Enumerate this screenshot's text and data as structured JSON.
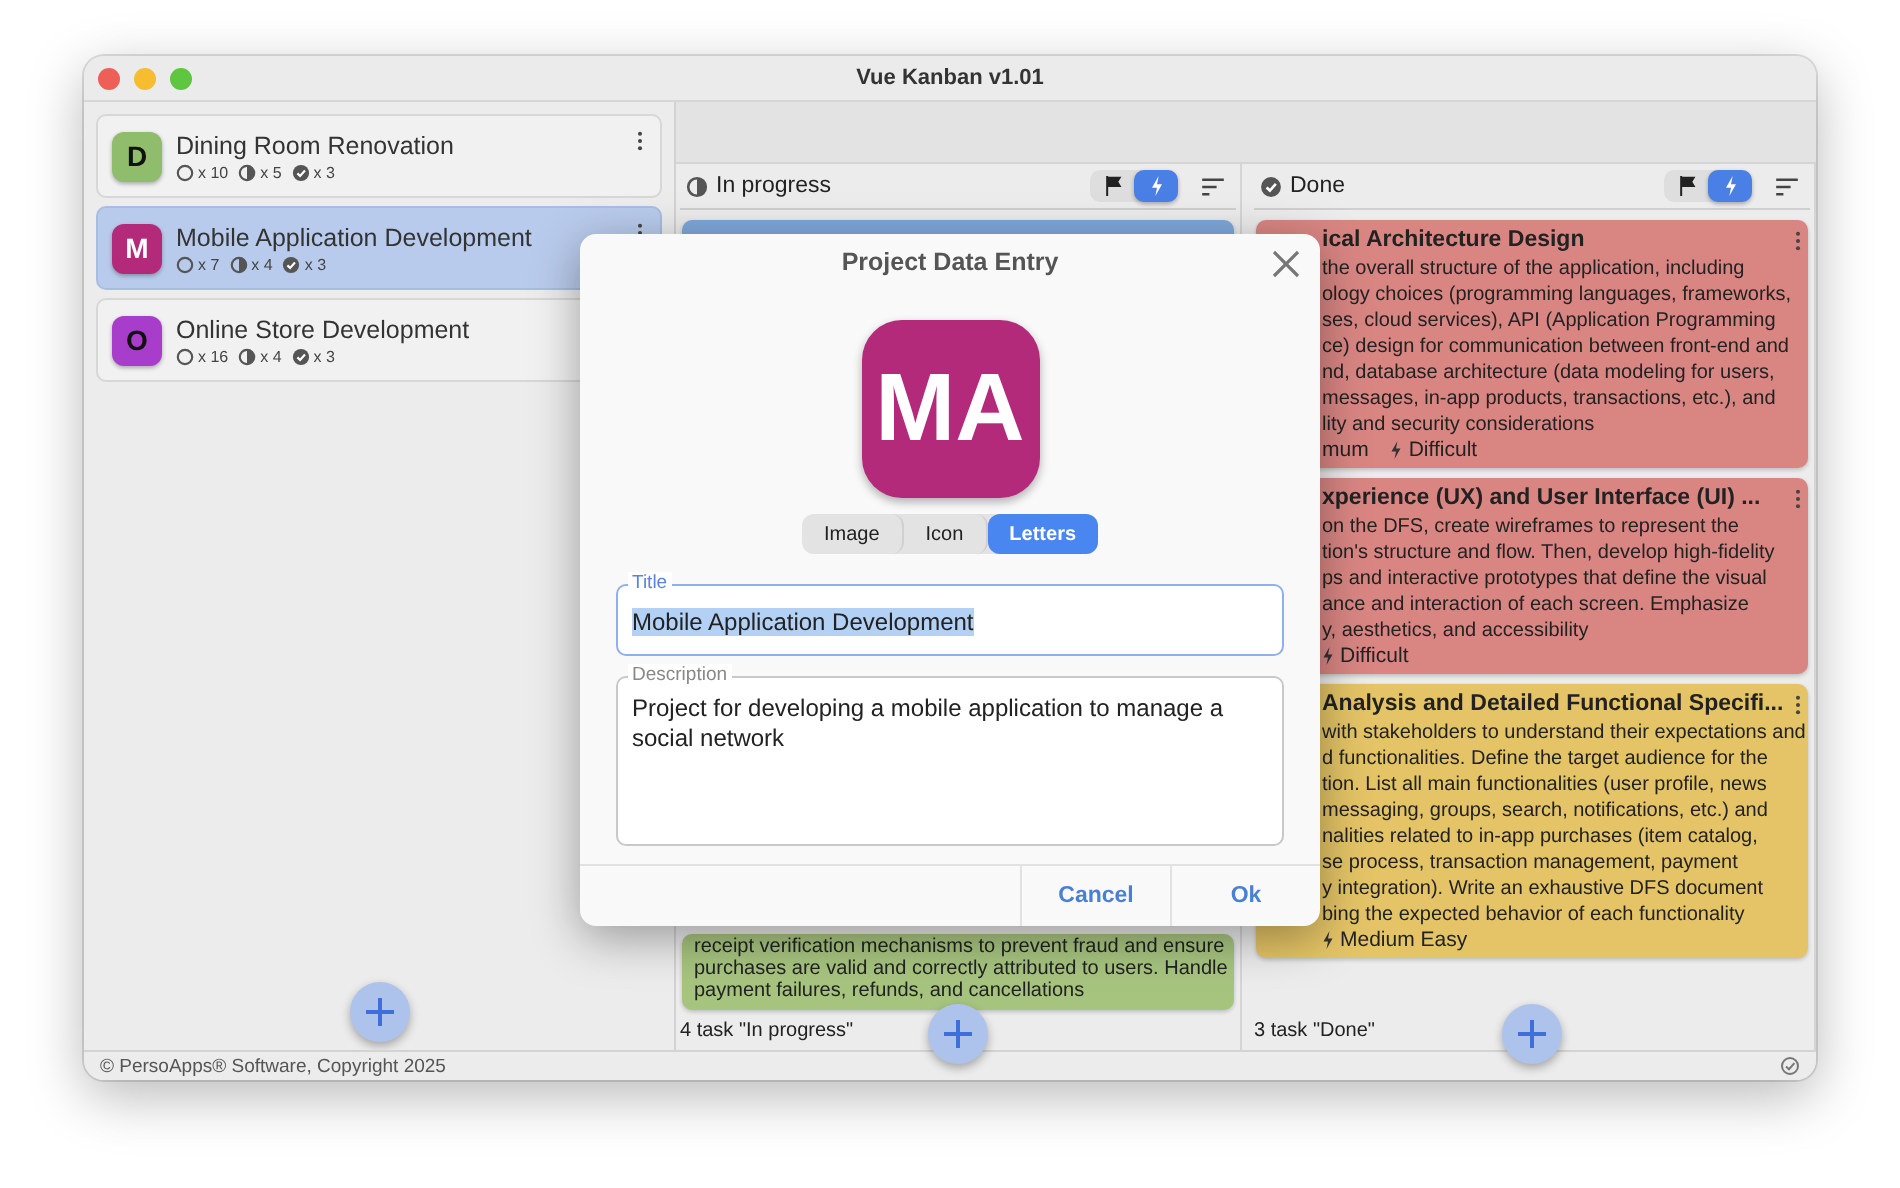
{
  "window": {
    "title": "Vue Kanban v1.01"
  },
  "projects": [
    {
      "letter": "D",
      "color": "#8fbd6c",
      "title": "Dining Room Renovation",
      "todo": "x 10",
      "in_progress": "x 5",
      "done": "x 3",
      "selected": false
    },
    {
      "letter": "M",
      "color": "#b42a7a",
      "title": "Mobile Application Development",
      "todo": "x 7",
      "in_progress": "x 4",
      "done": "x 3",
      "selected": true
    },
    {
      "letter": "O",
      "color": "#a83dcc",
      "title": "Online Store Development",
      "todo": "x 16",
      "in_progress": "x 4",
      "done": "x 3",
      "selected": false
    }
  ],
  "columns": [
    {
      "kind": "in_progress",
      "title": "In progress",
      "filters": [
        {
          "kind": "flag",
          "selected": false
        },
        {
          "kind": "bolt",
          "selected": true
        }
      ],
      "footer": "4 task \"In progress\"",
      "cards": [
        {
          "color": "#7ea8da"
        },
        {
          "color": "#a7c47f",
          "lines": [
            "receipt verification mechanisms to prevent fraud and ensure",
            "purchases are valid and correctly attributed to users. Handle",
            "payment failures, refunds, and cancellations"
          ]
        }
      ]
    },
    {
      "kind": "done",
      "title": "Done",
      "filters": [
        {
          "kind": "flag",
          "selected": false
        },
        {
          "kind": "bolt",
          "selected": true
        }
      ],
      "footer": "3 task \"Done\"",
      "cards": [
        {
          "color": "#d98683",
          "title": "ical Architecture Design",
          "lines": [
            "the overall structure of the application, including",
            "ology choices (programming languages, frameworks,",
            "ses, cloud services), API (Application Programming",
            "ce) design for communication between front-end and",
            "nd, database architecture (data modeling for users,",
            "messages, in-app products, transactions, etc.), and",
            "lity and security considerations"
          ],
          "tags": [
            {
              "kind": "text",
              "label": "mum"
            },
            {
              "kind": "bolt",
              "label": "Difficult"
            }
          ]
        },
        {
          "color": "#d98683",
          "title": "xperience (UX) and User Interface (UI) ...",
          "lines": [
            "on the DFS, create wireframes to represent the",
            "tion's structure and flow. Then, develop high-fidelity",
            "ps and interactive prototypes that define the visual",
            "ance and interaction of each screen. Emphasize",
            "y, aesthetics, and accessibility"
          ],
          "tags": [
            {
              "kind": "bolt",
              "label": "Difficult"
            }
          ]
        },
        {
          "color": "#e4c466",
          "title": "Analysis and Detailed Functional Specifi...",
          "lines": [
            "with stakeholders to understand their expectations and",
            "d functionalities. Define the target audience for the",
            "tion. List all main functionalities (user profile, news",
            "messaging, groups, search, notifications, etc.) and",
            "nalities related to in-app purchases (item catalog,",
            "se process, transaction management, payment",
            "y integration). Write an exhaustive DFS document",
            "bing the expected behavior of each functionality"
          ],
          "tags": [
            {
              "kind": "bolt",
              "label": "Medium Easy"
            }
          ]
        }
      ]
    }
  ],
  "modal": {
    "title": "Project Data Entry",
    "avatar_text": "MA",
    "modes": [
      {
        "label": "Image",
        "selected": false
      },
      {
        "label": "Icon",
        "selected": false
      },
      {
        "label": "Letters",
        "selected": true
      }
    ],
    "title_field": {
      "label": "Title",
      "value": "Mobile Application Development",
      "value_selected": true
    },
    "description_field": {
      "label": "Description",
      "value": "Project for developing a mobile application to manage a social network"
    },
    "buttons": [
      "Cancel",
      "Ok"
    ]
  },
  "status_bar": {
    "text": "© PersoApps® Software, Copyright 2025"
  }
}
